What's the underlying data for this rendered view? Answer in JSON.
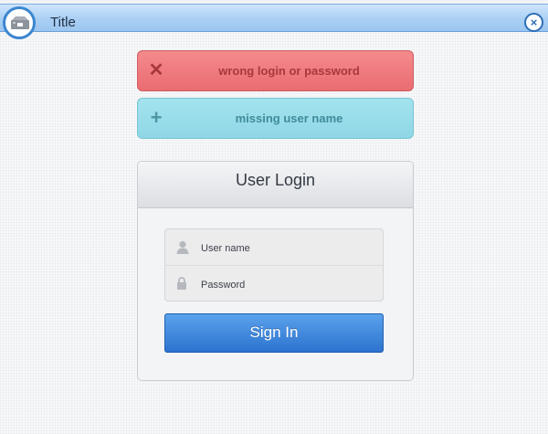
{
  "window": {
    "title": "Title",
    "close_glyph": "×",
    "icon": "mailbox-icon"
  },
  "alerts": [
    {
      "type": "error",
      "icon": "close-icon",
      "glyph": "✕",
      "text": "wrong login or password",
      "color": "#ea6c71"
    },
    {
      "type": "warning",
      "icon": "plus-icon",
      "glyph": "+",
      "text": "missing user name",
      "color": "#8fd7e6"
    }
  ],
  "login": {
    "title": "User Login",
    "username_label": "User name",
    "password_label": "Password",
    "submit_label": "Sign In",
    "accent_color": "#2d73cf"
  }
}
